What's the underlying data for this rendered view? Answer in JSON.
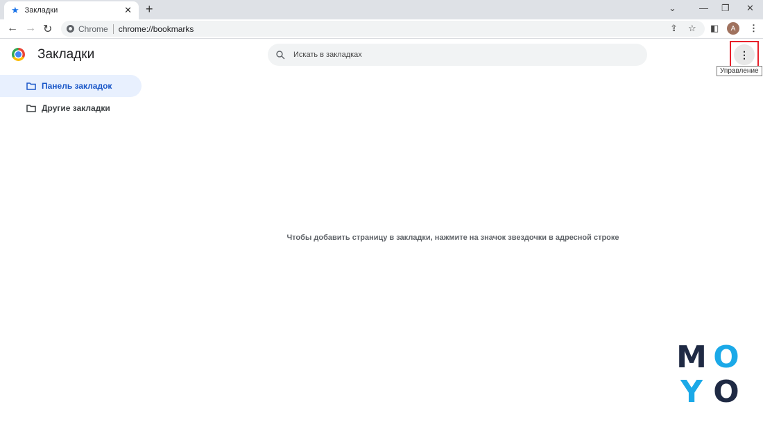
{
  "tab": {
    "title": "Закладки",
    "icon": "star-icon"
  },
  "toolbar": {
    "site_chip": "Chrome",
    "url": "chrome://bookmarks",
    "avatar_letter": "A"
  },
  "page": {
    "title": "Закладки",
    "search_placeholder": "Искать в закладках",
    "menu_tooltip": "Управление",
    "empty_message": "Чтобы добавить страницу в закладки, нажмите на значок звездочки в адресной строке"
  },
  "sidebar": {
    "items": [
      {
        "label": "Панель закладок",
        "active": true
      },
      {
        "label": "Другие закладки",
        "active": false
      }
    ]
  },
  "watermark": {
    "text": "MOYO",
    "letters": [
      "M",
      "O",
      "Y",
      "O"
    ],
    "colors": {
      "dark": "#1f2a44",
      "light": "#1ba9e8"
    }
  },
  "colors": {
    "accent": "#1a73e8",
    "highlight_box": "#e8202a"
  }
}
